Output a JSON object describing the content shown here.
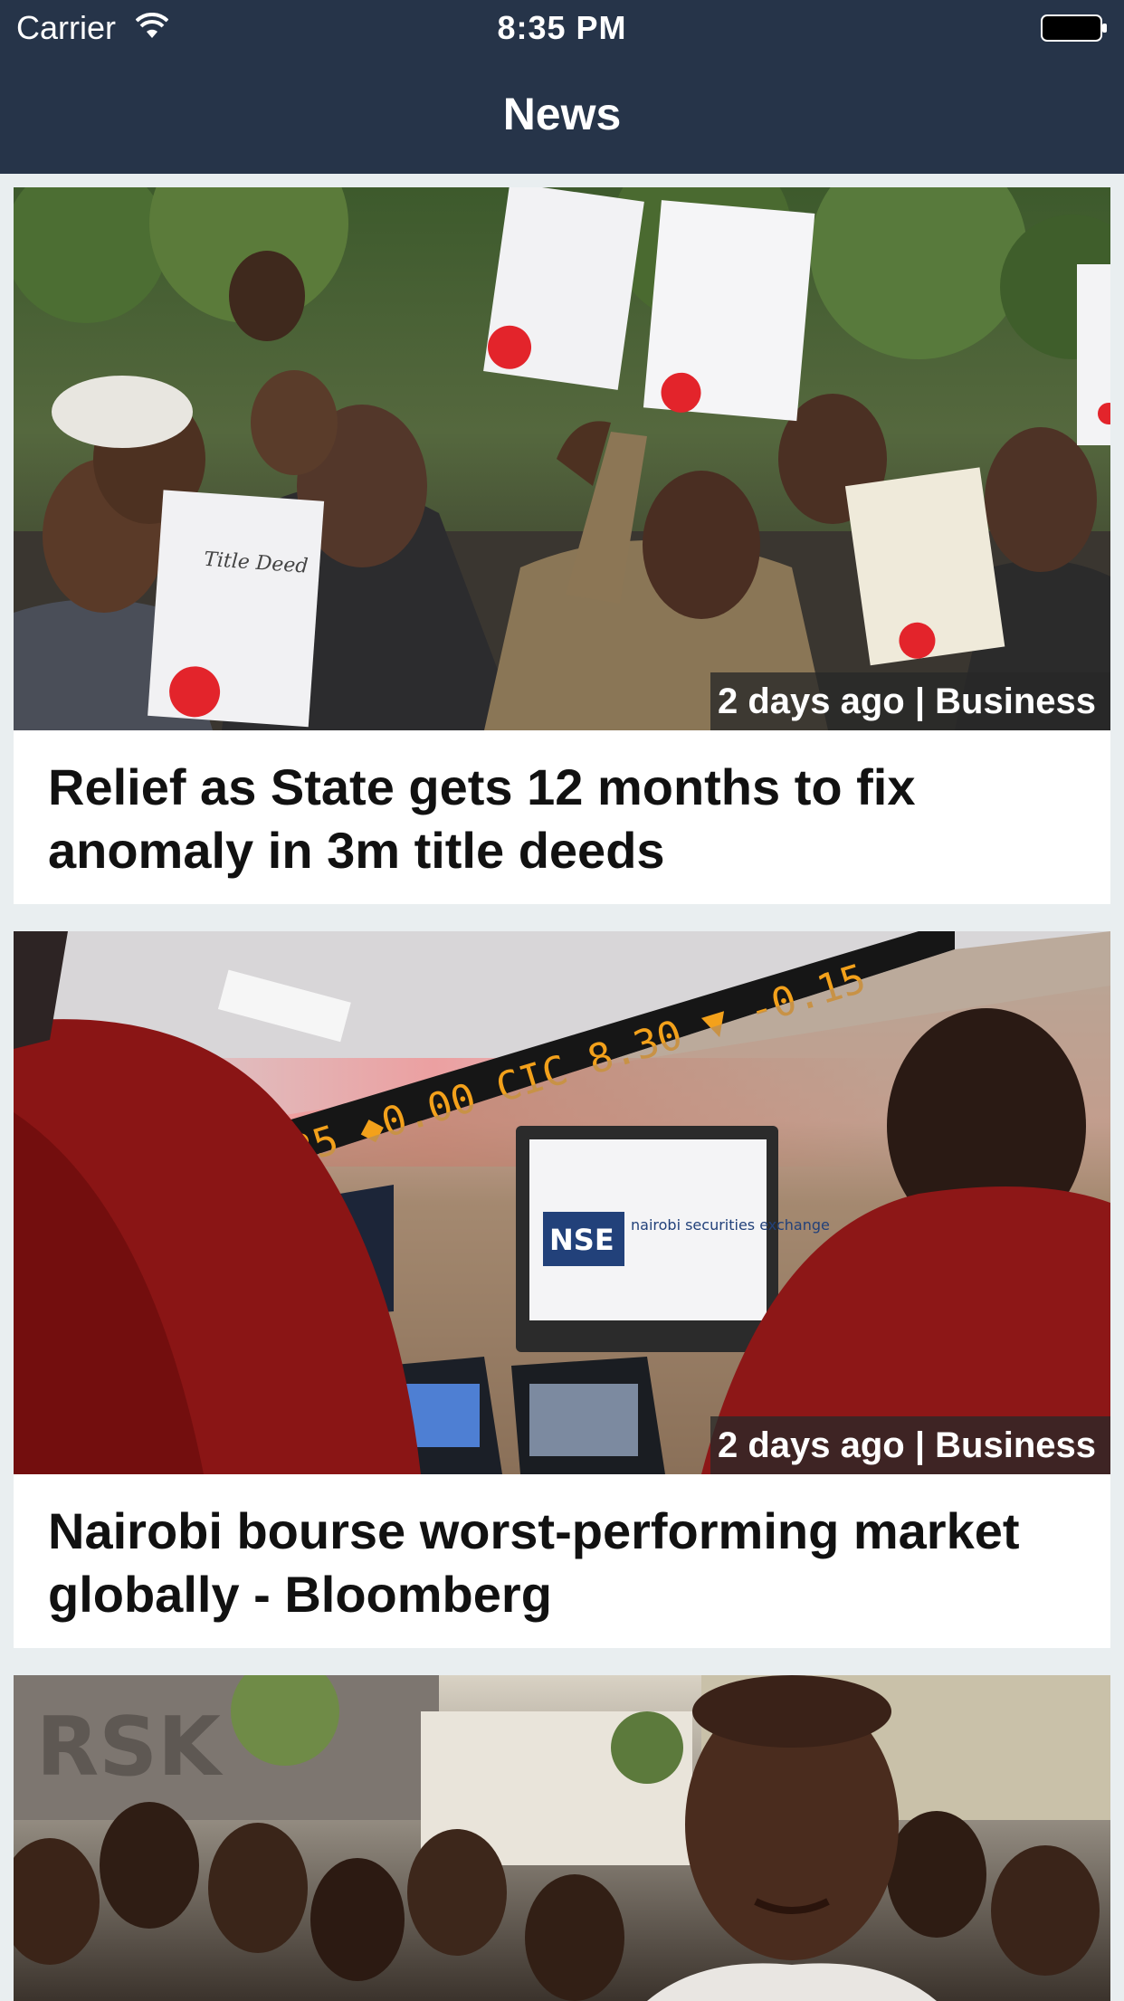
{
  "status_bar": {
    "carrier": "Carrier",
    "time": "8:35 PM",
    "wifi_icon": "wifi-icon",
    "battery_icon": "battery-icon"
  },
  "header": {
    "title": "News",
    "background": "#263449"
  },
  "articles": [
    {
      "time_ago": "2 days ago",
      "category": "Business",
      "meta": "2 days ago | Business",
      "title": "Relief as State gets 12 months to fix anomaly in 3m title deeds",
      "image": {
        "sign_lettering": "Title Deed"
      }
    },
    {
      "time_ago": "2 days ago",
      "category": "Business",
      "meta": "2 days ago | Business",
      "title": "Nairobi bourse worst-performing market globally - Bloomberg",
      "image": {
        "ticker_text": "13.25 ◆0.00 CIC 8.30 ▼ -0.15",
        "screen_logo": "NSE",
        "screen_text": "nairobi securities exchange"
      }
    },
    {
      "time_ago": "",
      "category": "",
      "meta": "",
      "title": "",
      "image": {
        "sign_lettering": "RSK"
      }
    }
  ]
}
